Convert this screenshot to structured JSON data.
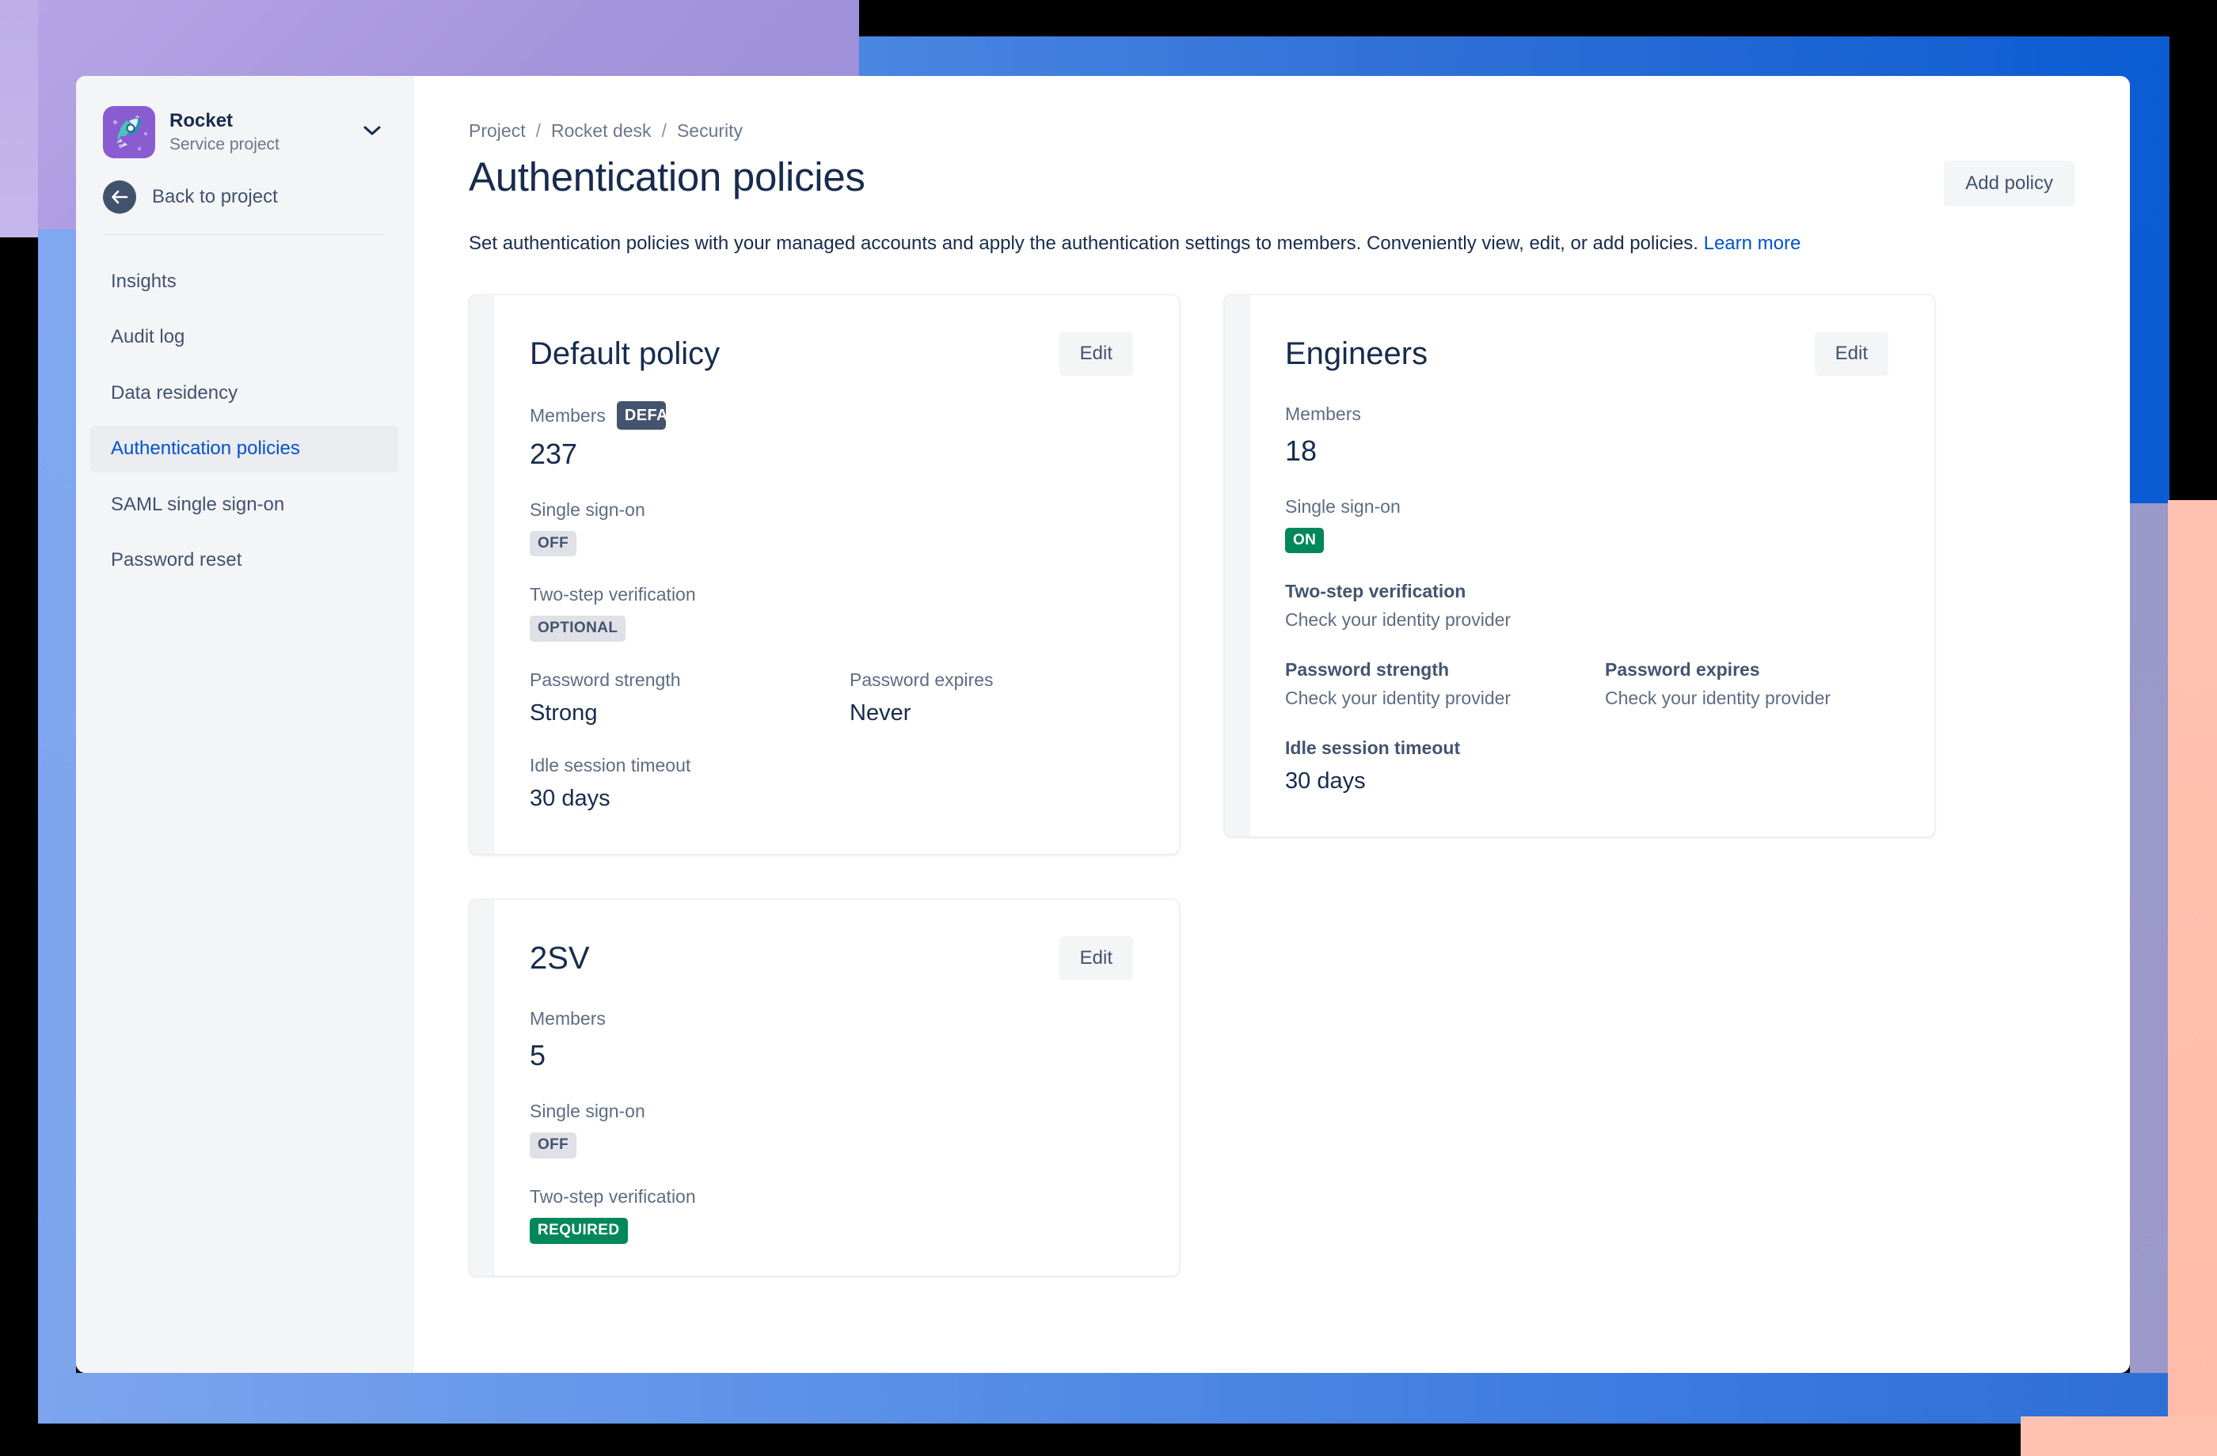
{
  "sidebar": {
    "project": {
      "name": "Rocket",
      "type": "Service project",
      "avatar_icon": "rocket-icon",
      "avatar_color": "#8A5CD1",
      "chevron_icon": "chevron-down-icon"
    },
    "back": {
      "label": "Back to project",
      "icon": "arrow-left-icon"
    },
    "items": [
      {
        "label": "Insights",
        "selected": false
      },
      {
        "label": "Audit log",
        "selected": false
      },
      {
        "label": "Data residency",
        "selected": false
      },
      {
        "label": "Authentication policies",
        "selected": true
      },
      {
        "label": "SAML single sign-on",
        "selected": false
      },
      {
        "label": "Password reset",
        "selected": false
      }
    ]
  },
  "header": {
    "breadcrumb": [
      "Project",
      "Rocket desk",
      "Security"
    ],
    "breadcrumb_separator": "/",
    "title": "Authentication policies",
    "add_policy_label": "Add policy",
    "description": "Set authentication policies with your managed accounts and apply the authentication settings to members. Conveniently view, edit, or add policies.",
    "learn_more_label": "Learn more"
  },
  "labels": {
    "members": "Members",
    "single_sign_on": "Single sign-on",
    "two_step_verification": "Two-step verification",
    "password_strength": "Password strength",
    "password_expires": "Password expires",
    "idle_session_timeout": "Idle session timeout",
    "edit": "Edit"
  },
  "colors": {
    "accent_blue": "#0052CC",
    "status_green": "#00875A",
    "lozenge_gray": "#DFE1E6",
    "badge_navy": "#44546F",
    "text_primary": "#172B4D",
    "text_subtle": "#5E6C84"
  },
  "policies": [
    {
      "name": "Default policy",
      "default_badge": "DEFAULT",
      "members": "237",
      "sso": {
        "value": "OFF",
        "style": "lozenge-gray"
      },
      "two_step": {
        "value": "OPTIONAL",
        "style": "lozenge-gray"
      },
      "password_strength": {
        "value": "Strong",
        "style": "text"
      },
      "password_expires": {
        "value": "Never",
        "style": "text"
      },
      "idle_timeout": "30 days"
    },
    {
      "name": "Engineers",
      "default_badge": null,
      "members": "18",
      "sso": {
        "value": "ON",
        "style": "lozenge-green"
      },
      "two_step": {
        "value": "Check your identity provider",
        "style": "muted"
      },
      "password_strength": {
        "value": "Check your identity provider",
        "style": "muted"
      },
      "password_expires": {
        "value": "Check your identity provider",
        "style": "muted"
      },
      "idle_timeout": "30 days"
    },
    {
      "name": "2SV",
      "default_badge": null,
      "members": "5",
      "sso": {
        "value": "OFF",
        "style": "lozenge-gray"
      },
      "two_step": {
        "value": "REQUIRED",
        "style": "lozenge-green"
      },
      "password_strength": null,
      "password_expires": null,
      "idle_timeout": null
    }
  ]
}
